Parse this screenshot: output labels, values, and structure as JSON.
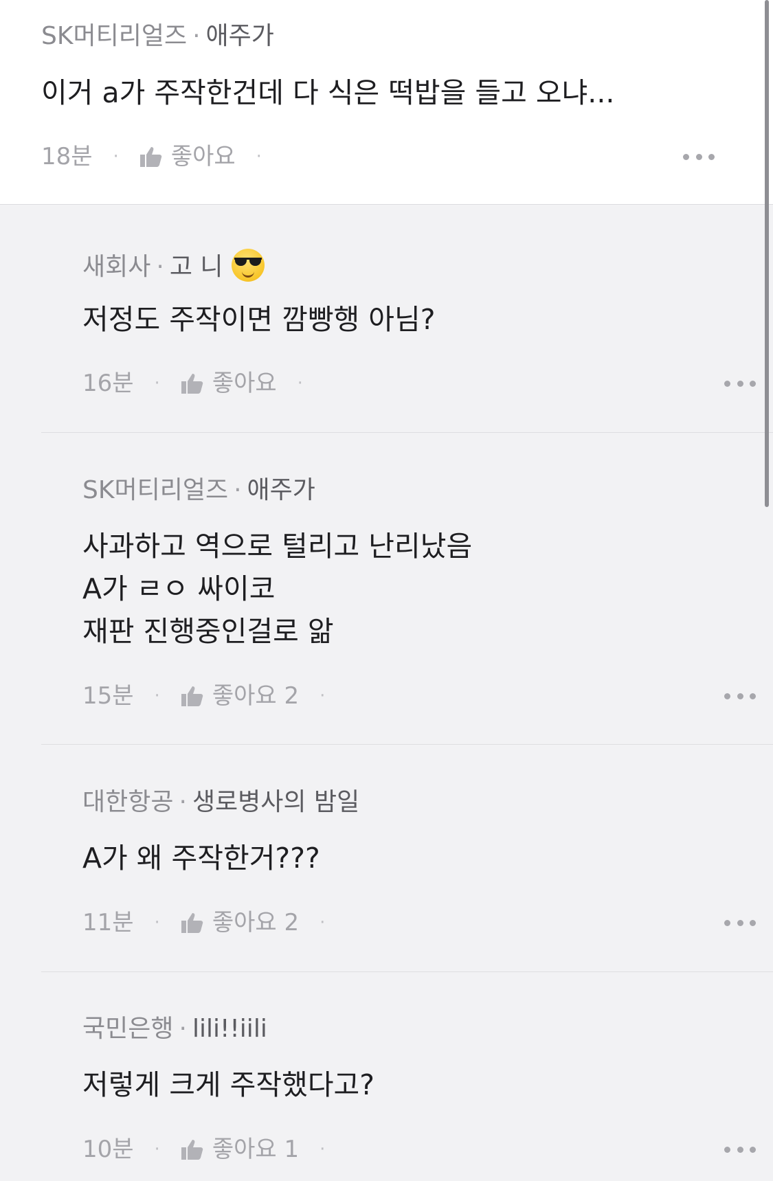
{
  "comments": [
    {
      "company": "SK머티리얼즈",
      "nickname": "애주가",
      "emoji": "",
      "text": "이거 a가 주작한건데 다 식은 떡밥을 들고 오냐...",
      "time": "18분",
      "like_label": "좋아요",
      "like_count": ""
    },
    {
      "company": "새회사",
      "nickname": "고 니",
      "emoji": "sunglasses-emoji",
      "text": "저정도 주작이면 깜빵행 아님?",
      "time": "16분",
      "like_label": "좋아요",
      "like_count": ""
    },
    {
      "company": "SK머티리얼즈",
      "nickname": "애주가",
      "emoji": "",
      "text_lines": [
        "사과하고 역으로 털리고 난리났음",
        "A가 ㄹㅇ 싸이코",
        "재판 진행중인걸로 앎"
      ],
      "time": "15분",
      "like_label": "좋아요",
      "like_count": "2"
    },
    {
      "company": "대한항공",
      "nickname": "생로병사의 밤일",
      "emoji": "",
      "text": "A가 왜 주작한거???",
      "time": "11분",
      "like_label": "좋아요",
      "like_count": "2"
    },
    {
      "company": "국민은행",
      "nickname": "lili!!iili",
      "emoji": "",
      "text": "저렇게 크게 주작했다고?",
      "time": "10분",
      "like_label": "좋아요",
      "like_count": "1"
    }
  ],
  "separator": "·",
  "icons": {
    "like": "thumbs-up-icon",
    "more": "more-options-icon"
  },
  "colors": {
    "top_background": "#ffffff",
    "reply_background": "#f2f2f4",
    "text": "#1e1e21",
    "meta": "#a4a4a9"
  }
}
